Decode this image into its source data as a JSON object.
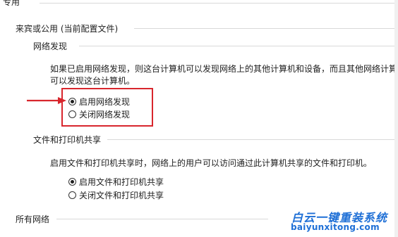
{
  "sections": {
    "private": "专用",
    "guest_public": "来宾或公用 (当前配置文件)",
    "all_networks": "所有网络"
  },
  "network_discovery": {
    "title": "网络发现",
    "desc_line1": "如果已启用网络发现，则这台计算机可以发现网络上的其他计算机和设备，而且其他网络计算机",
    "desc_line2": "可以发现这台计算机。",
    "options": [
      {
        "label": "启用网络发现",
        "checked": true
      },
      {
        "label": "关闭网络发现",
        "checked": false
      }
    ]
  },
  "file_sharing": {
    "title": "文件和打印机共享",
    "desc": "启用文件和打印机共享时，网络上的用户可以访问通过此计算机共享的文件和打印机。",
    "options": [
      {
        "label": "启用文件和打印机共享",
        "checked": true
      },
      {
        "label": "关闭文件和打印机共享",
        "checked": false
      }
    ]
  },
  "annotation": {
    "arrow_color": "#d8262d",
    "box_color": "#d8262d"
  },
  "watermark": {
    "text": "白云一键重装系统",
    "url": "baiyunxitong.com"
  }
}
